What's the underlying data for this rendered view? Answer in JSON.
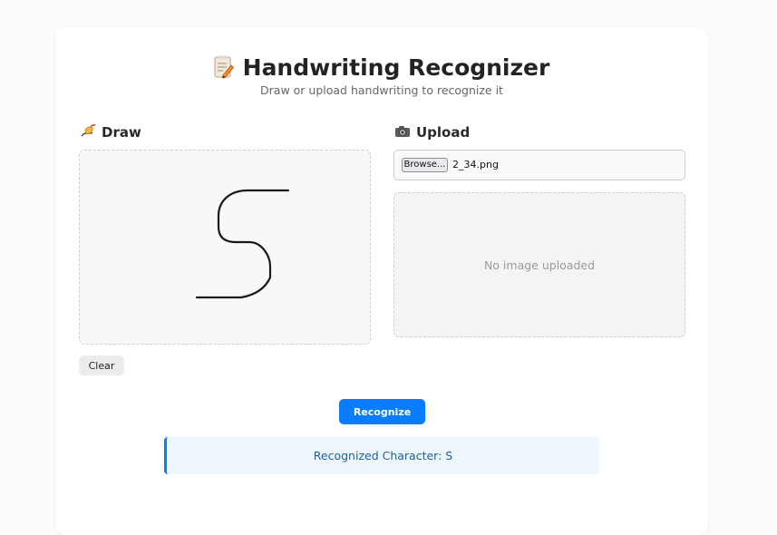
{
  "header": {
    "title": "Handwriting Recognizer",
    "subtitle": "Draw or upload handwriting to recognize it",
    "title_icon": "memo-icon"
  },
  "draw": {
    "title": "Draw",
    "icon": "writing-hand-icon",
    "clear_label": "Clear"
  },
  "upload": {
    "title": "Upload",
    "icon": "camera-icon",
    "browse_label": "Browse...",
    "file_name": "2_34.png",
    "preview_placeholder": "No image uploaded"
  },
  "actions": {
    "recognize_label": "Recognize"
  },
  "result": {
    "text": "Recognized Character: S"
  },
  "colors": {
    "accent": "#0a7cff",
    "result_bg": "#eef6fd",
    "result_text": "#1c5f99"
  }
}
